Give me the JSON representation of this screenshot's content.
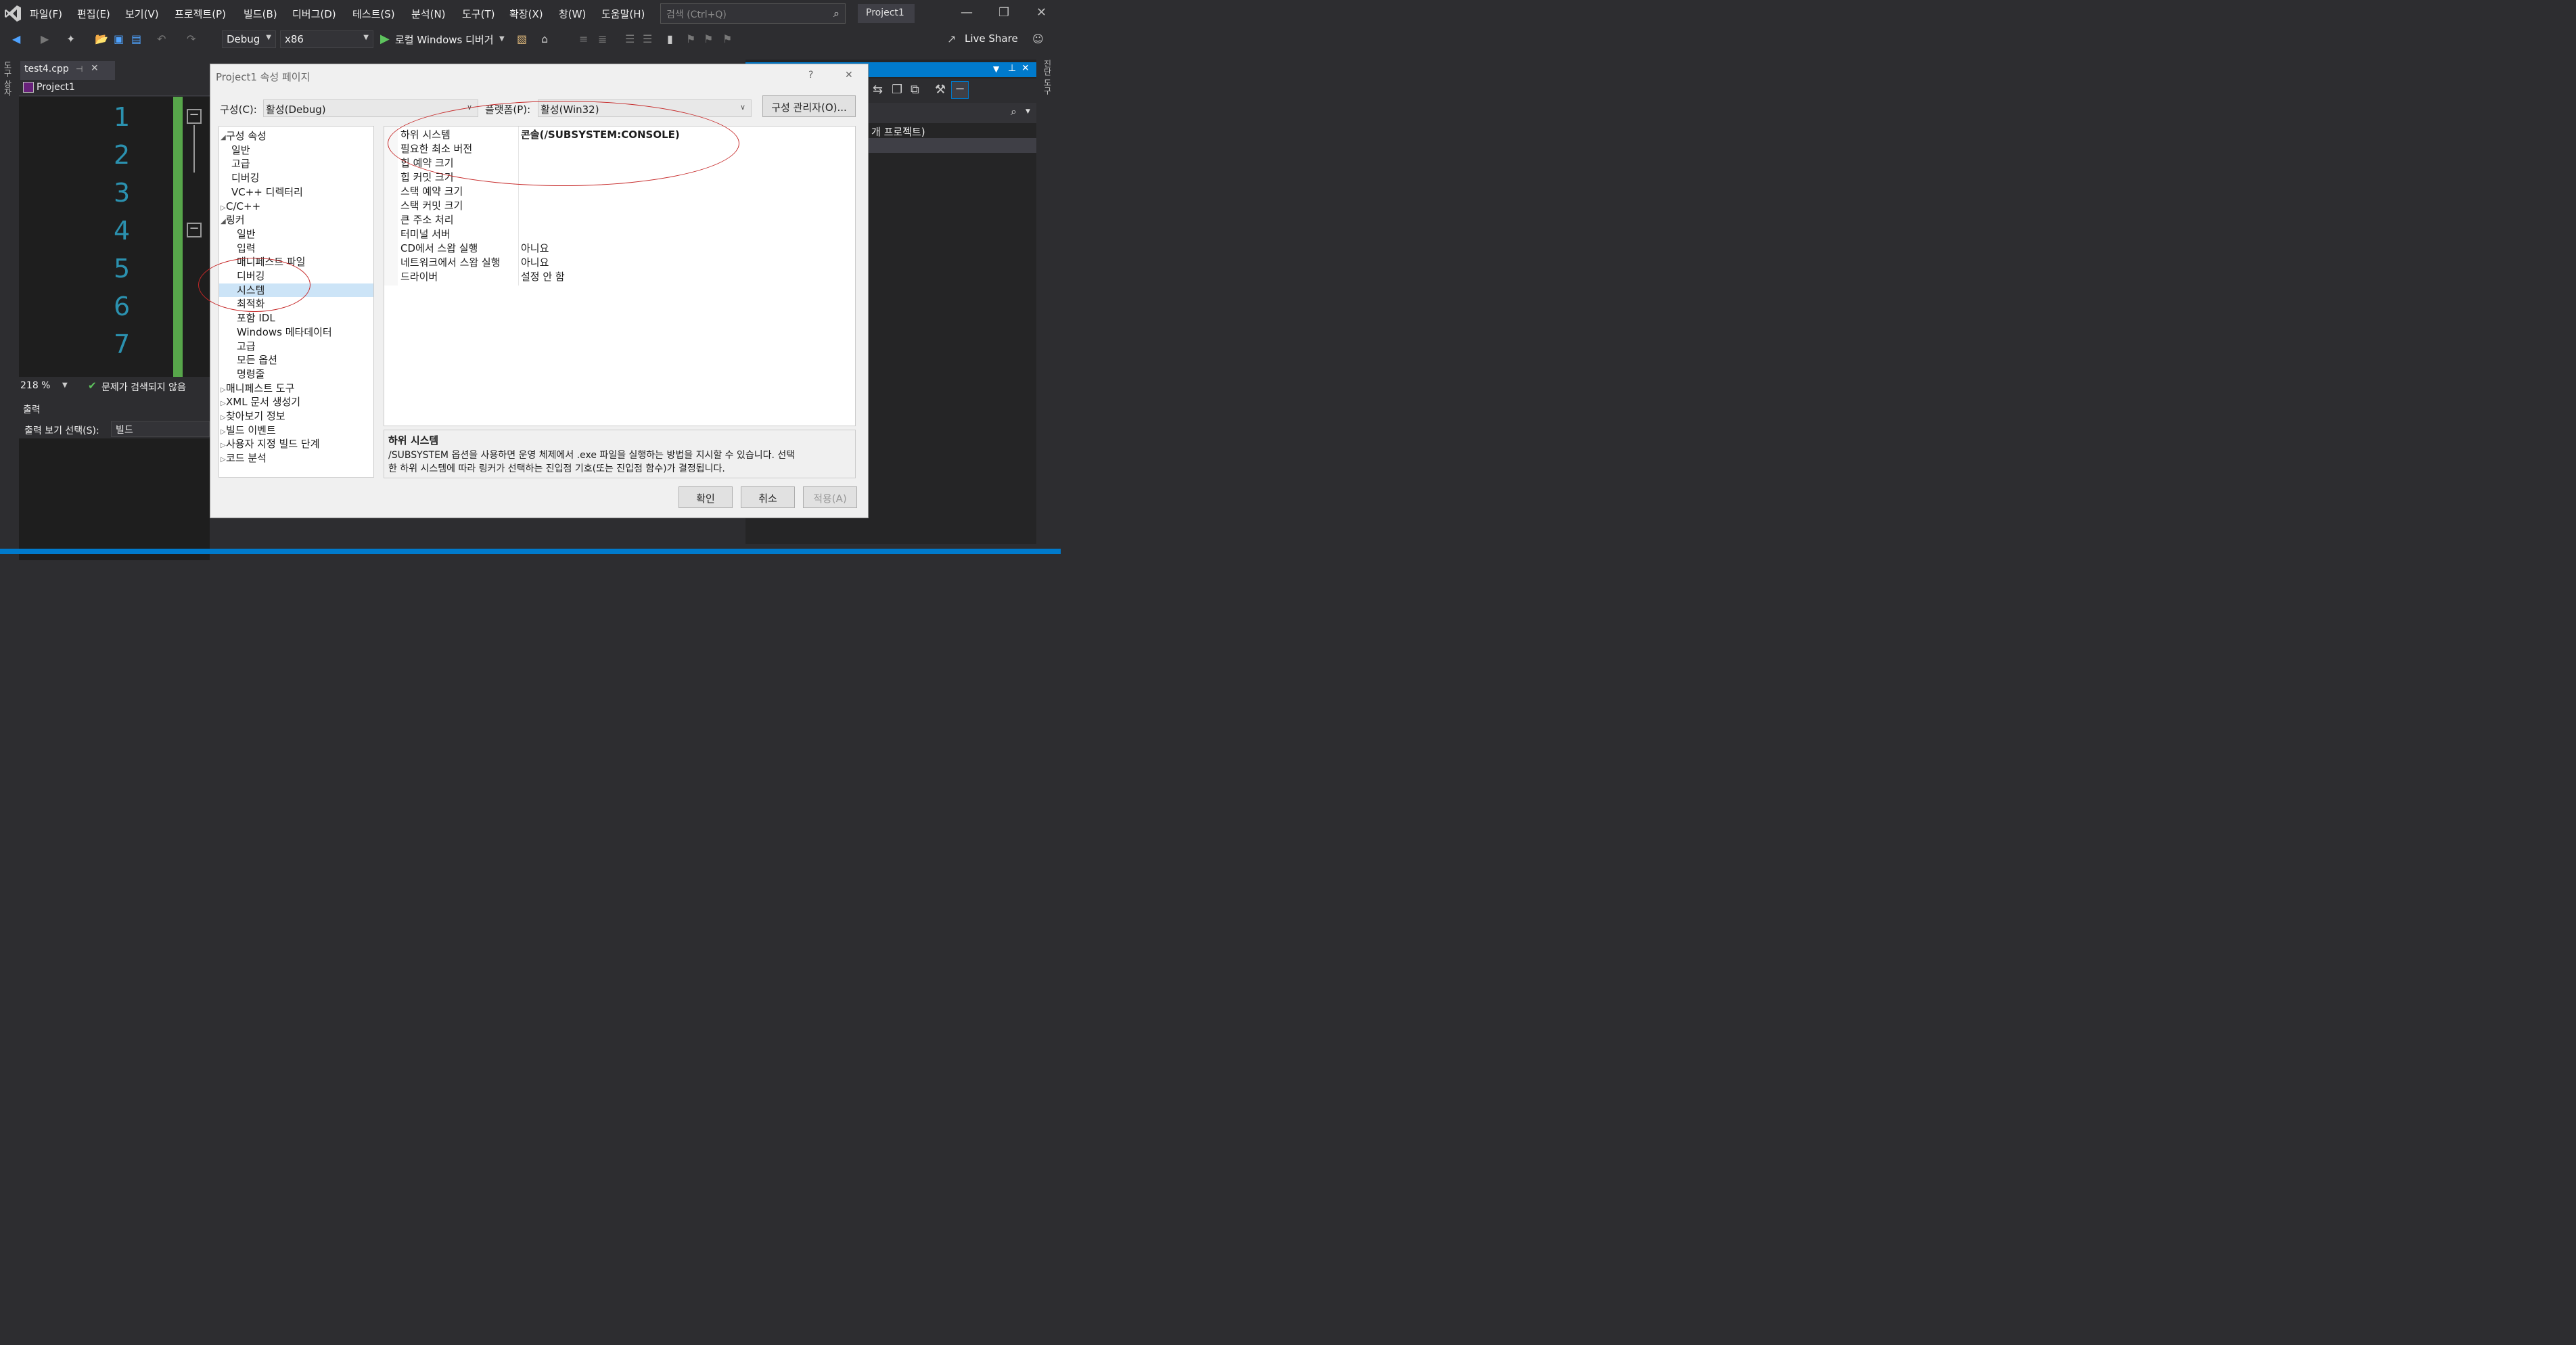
{
  "menubar": {
    "items": [
      "파일(F)",
      "편집(E)",
      "보기(V)",
      "프로젝트(P)",
      "빌드(B)",
      "디버그(D)",
      "테스트(S)",
      "분석(N)",
      "도구(T)",
      "확장(X)",
      "창(W)",
      "도움말(H)"
    ],
    "search_placeholder": "검색 (Ctrl+Q)",
    "project_name": "Project1"
  },
  "toolbar": {
    "config": "Debug",
    "platform": "x86",
    "run_label": "로컬 Windows 디버거",
    "live_share": "Live Share"
  },
  "left_strip": {
    "label": "도구 상자"
  },
  "right_strip": {
    "label": "진단 도구"
  },
  "editor": {
    "tab_label": "test4.cpp",
    "nav_project": "Project1",
    "line_numbers": [
      "1",
      "2",
      "3",
      "4",
      "5",
      "6",
      "7"
    ],
    "zoom": "218 %",
    "status": "문제가 검색되지 않음"
  },
  "output": {
    "title": "출력",
    "source_label": "출력 보기 선택(S):",
    "source_value": "빌드"
  },
  "right_panel": {
    "project_text": "개 프로젝트)"
  },
  "dialog": {
    "title": "Project1 속성 페이지",
    "help": "?",
    "config_label": "구성(C):",
    "config_value": "활성(Debug)",
    "platform_label": "플랫폼(P):",
    "platform_value": "활성(Win32)",
    "config_manager": "구성 관리자(O)...",
    "tree": [
      {
        "label": "구성 속성",
        "expander": "◢"
      },
      {
        "label": "일반",
        "expander": ""
      },
      {
        "label": "고급",
        "expander": ""
      },
      {
        "label": "디버깅",
        "expander": ""
      },
      {
        "label": "VC++ 디렉터리",
        "expander": ""
      },
      {
        "label": "C/C++",
        "expander": "▷"
      },
      {
        "label": "링커",
        "expander": "◢"
      },
      {
        "label": "일반",
        "expander": ""
      },
      {
        "label": "입력",
        "expander": ""
      },
      {
        "label": "매니페스트 파일",
        "expander": ""
      },
      {
        "label": "디버깅",
        "expander": ""
      },
      {
        "label": "시스템",
        "expander": "",
        "selected": true
      },
      {
        "label": "최적화",
        "expander": ""
      },
      {
        "label": "포함 IDL",
        "expander": ""
      },
      {
        "label": "Windows 메타데이터",
        "expander": ""
      },
      {
        "label": "고급",
        "expander": ""
      },
      {
        "label": "모든 옵션",
        "expander": ""
      },
      {
        "label": "명령줄",
        "expander": ""
      },
      {
        "label": "매니페스트 도구",
        "expander": "▷"
      },
      {
        "label": "XML 문서 생성기",
        "expander": "▷"
      },
      {
        "label": "찾아보기 정보",
        "expander": "▷"
      },
      {
        "label": "빌드 이벤트",
        "expander": "▷"
      },
      {
        "label": "사용자 지정 빌드 단계",
        "expander": "▷"
      },
      {
        "label": "코드 분석",
        "expander": "▷"
      }
    ],
    "properties": [
      {
        "name": "하위 시스템",
        "value": "콘솔(/SUBSYSTEM:CONSOLE)",
        "bold": true
      },
      {
        "name": "필요한 최소 버전",
        "value": ""
      },
      {
        "name": "힙 예약 크기",
        "value": ""
      },
      {
        "name": "힙 커밋 크기",
        "value": ""
      },
      {
        "name": "스택 예약 크기",
        "value": ""
      },
      {
        "name": "스택 커밋 크기",
        "value": ""
      },
      {
        "name": "큰 주소 처리",
        "value": ""
      },
      {
        "name": "터미널 서버",
        "value": ""
      },
      {
        "name": "CD에서 스왑 실행",
        "value": "아니요"
      },
      {
        "name": "네트워크에서 스왑 실행",
        "value": "아니요"
      },
      {
        "name": "드라이버",
        "value": "설정 안 함"
      }
    ],
    "desc_title": "하위 시스템",
    "desc_line1": "/SUBSYSTEM 옵션을 사용하면 운영 체제에서 .exe 파일을 실행하는 방법을 지시할 수 있습니다. 선택",
    "desc_line2": "한 하위 시스템에 따라 링커가 선택하는 진입점 기호(또는 진입점 함수)가 결정됩니다.",
    "ok": "확인",
    "cancel": "취소",
    "apply": "적용(A)"
  },
  "annotation_color": "#c62828"
}
